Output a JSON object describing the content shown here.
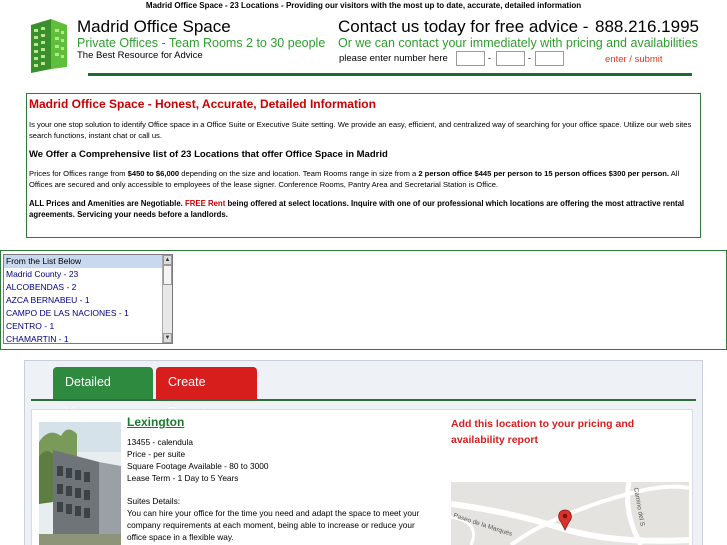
{
  "banner": {
    "text": "Madrid Office Space - 23 Locations - Providing our visitors with the most up to date, accurate, detailed information"
  },
  "brand": {
    "title": "Madrid Office Space",
    "subtitle": "Private Offices - Team Rooms 2 to 30 people",
    "tagline": "The Best Resource for Advice",
    "logo_icon": "green-office-building-icon"
  },
  "contact": {
    "title": "Contact us today for free advice -",
    "phone": "888.216.1995",
    "subtitle": "Or we can contact your immediately with pricing and availabilities",
    "prompt": "please enter number here",
    "dash": "-",
    "submit_label": "enter / submit"
  },
  "info": {
    "heading": "Madrid Office Space - Honest, Accurate, Detailed Information",
    "intro": "Is your one stop solution to identify Office space in a Office Suite or Executive Suite setting. We provide an easy, efficient, and centralized way of searching for your office space. Utilize our web sites search functions, instant chat or call us.",
    "subheading": "We Offer a Comprehensive list of 23 Locations that offer Office Space in Madrid",
    "prices": {
      "part1": "Prices for Offices range from ",
      "range": "$450 to $6,000",
      "part2": " depending on the size and location. Team Rooms range in size from a ",
      "team": "2 person office $445 per person to 15 person offices $300 per person.",
      "part3": " All Offices are secured and only accessible to employees of the lease signer. Conference Rooms, Pantry Area and Secretarial Station is Office."
    },
    "negotiable": {
      "part1": "ALL Prices and Amenities are Negotiable. ",
      "free": "FREE Rent",
      "part2": " being offered at select locations. Inquire with one of our professional which locations are offering the most attractive rental agreements. Servicing your needs before a landlords."
    }
  },
  "location_list": {
    "items": [
      "From the List Below",
      "Madrid County - 23",
      "ALCOBENDAS - 2",
      "AZCA BERNABEU - 1",
      "CAMPO DE LAS NACIONES - 1",
      "CENTRO - 1",
      "CHAMARTIN - 1"
    ],
    "selected_index": 0
  },
  "tabs": [
    {
      "label": "Detailed View",
      "color": "#2d8a3e"
    },
    {
      "label": "Create Report",
      "color": "#d81d1d"
    }
  ],
  "listing": {
    "name": "Lexington",
    "address": "13455 - calendula",
    "price": "Price - per suite",
    "footage": "Square Footage Available - 80 to 3000",
    "term": "Lease Term - 1 Day to 5 Years",
    "suites_label": "Suites Details:",
    "details_1": "You can hire your office for the time you need and adapt the space to meet your",
    "details_2": "company requirements at each moment, being able to increase or reduce your",
    "details_3": "office space in a flexible way.",
    "add_report": "Add this location to your pricing and availability report",
    "map_label_1": "Paseo de la Marqués",
    "map_label_2": "Camino del S",
    "map_icon": "map-pin-icon"
  }
}
